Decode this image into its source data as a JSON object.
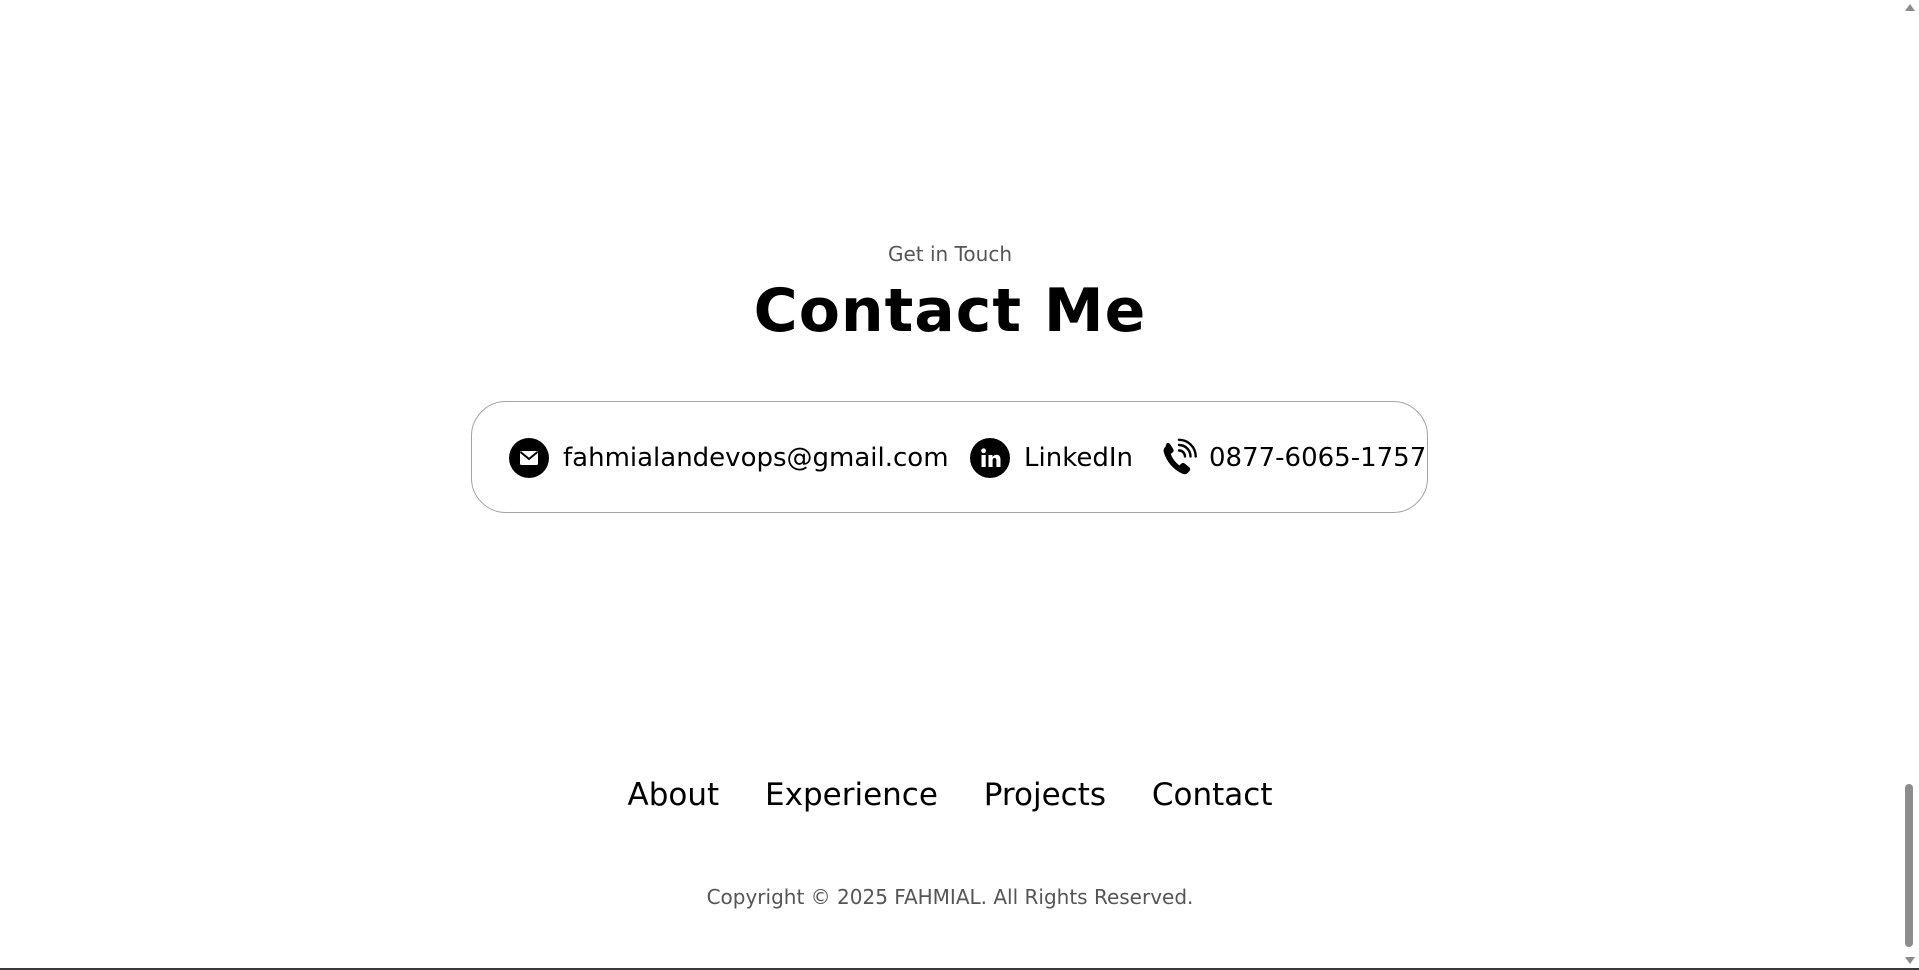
{
  "contact_section": {
    "subtitle": "Get in Touch",
    "title": "Contact Me",
    "email": {
      "icon": "envelope-icon",
      "label": "fahmialandevops@gmail.com"
    },
    "linkedin": {
      "icon": "linkedin-icon",
      "label": "LinkedIn"
    },
    "phone": {
      "icon": "phone-icon",
      "label": "0877-6065-1757"
    }
  },
  "footer": {
    "nav": [
      "About",
      "Experience",
      "Projects",
      "Contact"
    ],
    "copyright": "Copyright © 2025 FAHMIAL. All Rights Reserved."
  },
  "colors": {
    "text": "#000000",
    "muted_text": "#555555",
    "border": "#a3a3a3",
    "background": "#ffffff"
  }
}
